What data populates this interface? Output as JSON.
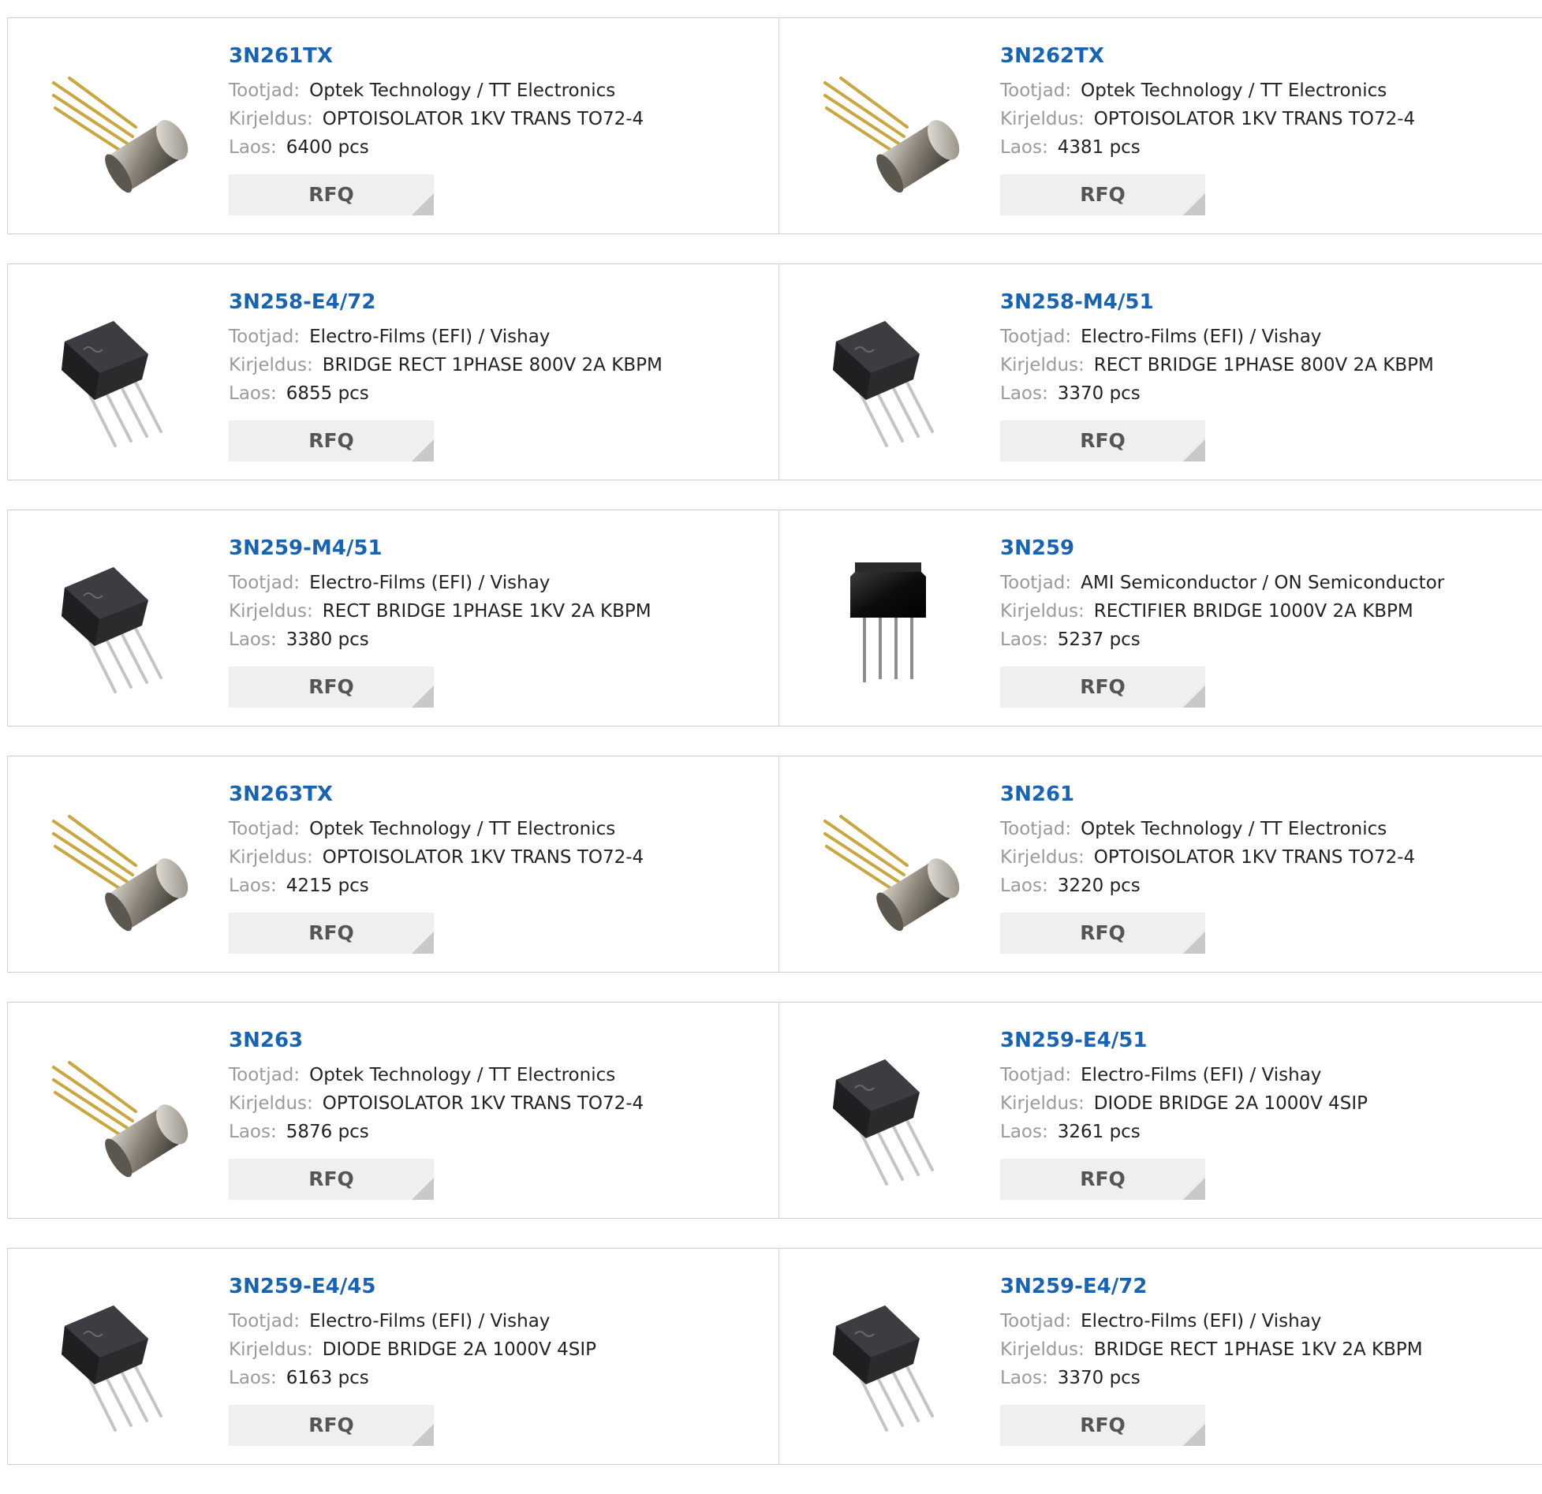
{
  "labels": {
    "manufacturer": "Tootjad:",
    "description": "Kirjeldus:",
    "stock": "Laos:",
    "rfq": "RFQ"
  },
  "products": [
    {
      "part": "3N261TX",
      "manufacturer": "Optek Technology / TT Electronics",
      "description": "OPTOISOLATOR 1KV TRANS TO72-4",
      "stock": "6400 pcs",
      "image": "to72-can"
    },
    {
      "part": "3N262TX",
      "manufacturer": "Optek Technology / TT Electronics",
      "description": "OPTOISOLATOR 1KV TRANS TO72-4",
      "stock": "4381 pcs",
      "image": "to72-can"
    },
    {
      "part": "3N258-E4/72",
      "manufacturer": "Electro-Films (EFI) / Vishay",
      "description": "BRIDGE RECT 1PHASE 800V 2A KBPM",
      "stock": "6855 pcs",
      "image": "kbpm-bridge"
    },
    {
      "part": "3N258-M4/51",
      "manufacturer": "Electro-Films (EFI) / Vishay",
      "description": "RECT BRIDGE 1PHASE 800V 2A KBPM",
      "stock": "3370 pcs",
      "image": "kbpm-bridge"
    },
    {
      "part": "3N259-M4/51",
      "manufacturer": "Electro-Films (EFI) / Vishay",
      "description": "RECT BRIDGE 1PHASE 1KV 2A KBPM",
      "stock": "3380 pcs",
      "image": "kbpm-bridge"
    },
    {
      "part": "3N259",
      "manufacturer": "AMI Semiconductor / ON Semiconductor",
      "description": "RECTIFIER BRIDGE 1000V 2A KBPM",
      "stock": "5237 pcs",
      "image": "sip-bridge"
    },
    {
      "part": "3N263TX",
      "manufacturer": "Optek Technology / TT Electronics",
      "description": "OPTOISOLATOR 1KV TRANS TO72-4",
      "stock": "4215 pcs",
      "image": "to72-can"
    },
    {
      "part": "3N261",
      "manufacturer": "Optek Technology / TT Electronics",
      "description": "OPTOISOLATOR 1KV TRANS TO72-4",
      "stock": "3220 pcs",
      "image": "to72-can"
    },
    {
      "part": "3N263",
      "manufacturer": "Optek Technology / TT Electronics",
      "description": "OPTOISOLATOR 1KV TRANS TO72-4",
      "stock": "5876 pcs",
      "image": "to72-can"
    },
    {
      "part": "3N259-E4/51",
      "manufacturer": "Electro-Films (EFI) / Vishay",
      "description": "DIODE BRIDGE 2A 1000V 4SIP",
      "stock": "3261 pcs",
      "image": "kbpm-bridge"
    },
    {
      "part": "3N259-E4/45",
      "manufacturer": "Electro-Films (EFI) / Vishay",
      "description": "DIODE BRIDGE 2A 1000V 4SIP",
      "stock": "6163 pcs",
      "image": "kbpm-bridge"
    },
    {
      "part": "3N259-E4/72",
      "manufacturer": "Electro-Films (EFI) / Vishay",
      "description": "BRIDGE RECT 1PHASE 1KV 2A KBPM",
      "stock": "3370 pcs",
      "image": "kbpm-bridge"
    }
  ],
  "colors": {
    "link": "#1a63b0",
    "label": "#9a9a9a",
    "border": "#cfcfcf",
    "button_bg": "#efefef"
  }
}
